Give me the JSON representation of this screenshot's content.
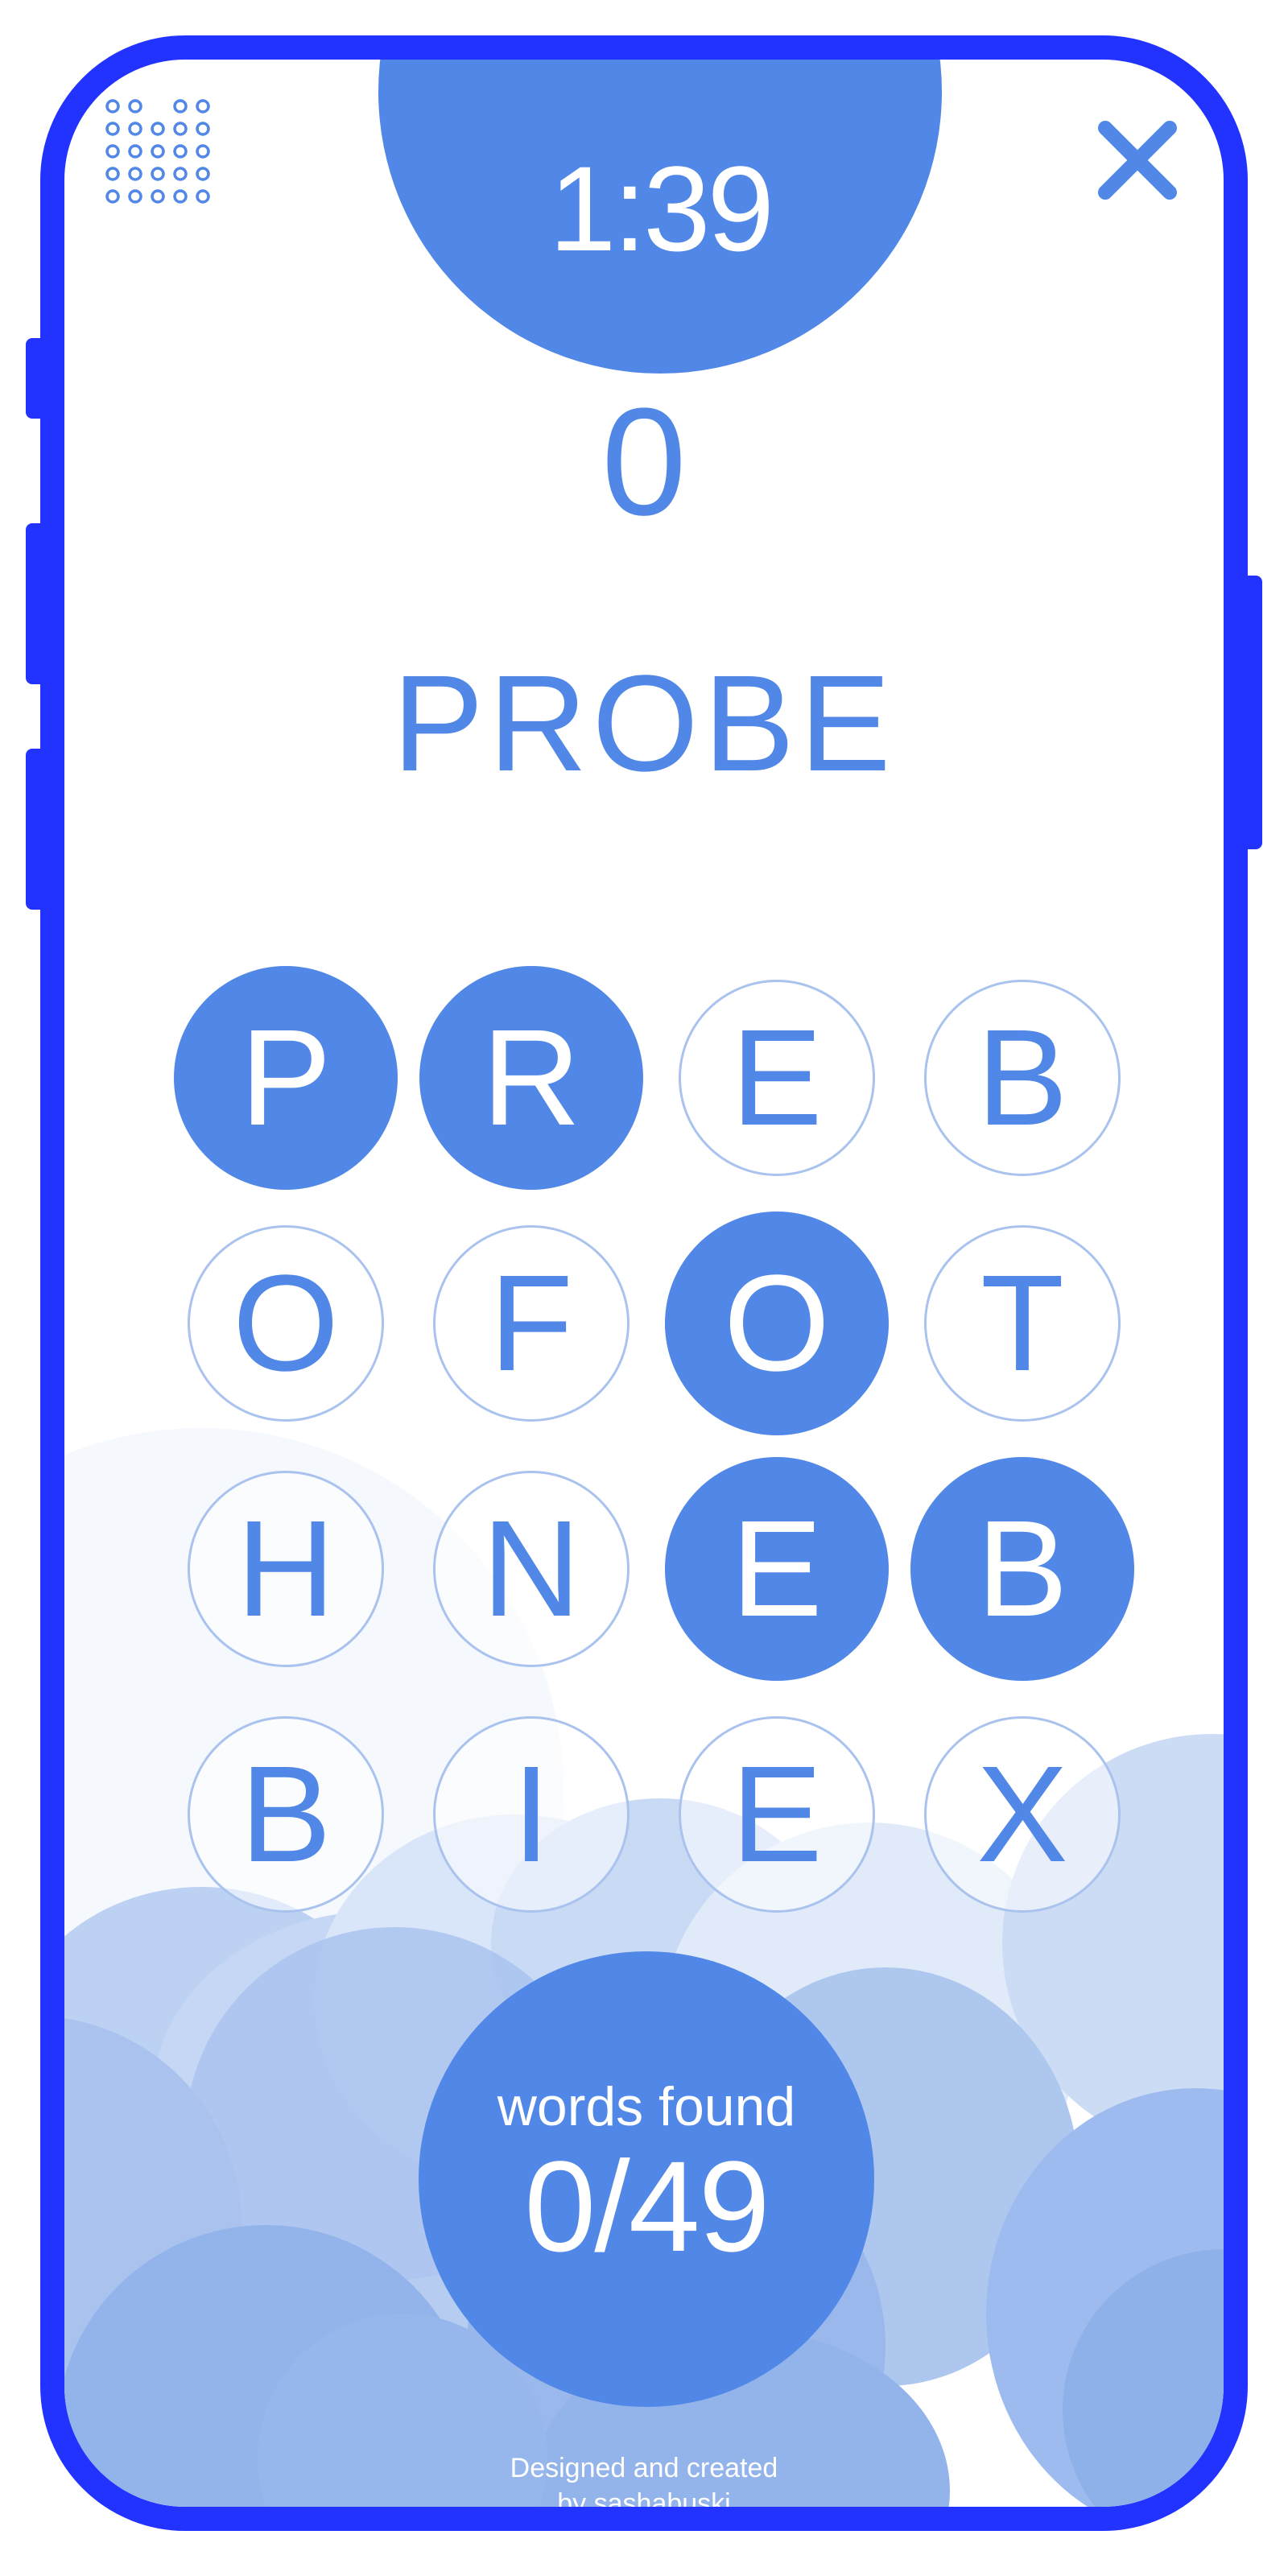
{
  "game": {
    "timer": "1:39",
    "score": "0",
    "current_word": "PROBE",
    "grid": [
      {
        "letter": "P",
        "selected": true
      },
      {
        "letter": "R",
        "selected": true
      },
      {
        "letter": "E",
        "selected": false
      },
      {
        "letter": "B",
        "selected": false
      },
      {
        "letter": "O",
        "selected": false
      },
      {
        "letter": "F",
        "selected": false
      },
      {
        "letter": "O",
        "selected": true
      },
      {
        "letter": "T",
        "selected": false
      },
      {
        "letter": "H",
        "selected": false
      },
      {
        "letter": "N",
        "selected": false
      },
      {
        "letter": "E",
        "selected": true
      },
      {
        "letter": "B",
        "selected": true
      },
      {
        "letter": "B",
        "selected": false
      },
      {
        "letter": "I",
        "selected": false
      },
      {
        "letter": "E",
        "selected": false
      },
      {
        "letter": "X",
        "selected": false
      }
    ],
    "words_found": {
      "label": "words found",
      "count": "0/49"
    }
  },
  "credits": {
    "line1": "Designed and created",
    "line2": "by sashabuski"
  },
  "icons": {
    "logo": "dot-matrix-logo-icon",
    "close": "close-icon"
  },
  "colors": {
    "frame": "#2233ff",
    "accent": "#5187e6",
    "tile_outline": "#a9c3ee",
    "background": "#ffffff"
  }
}
